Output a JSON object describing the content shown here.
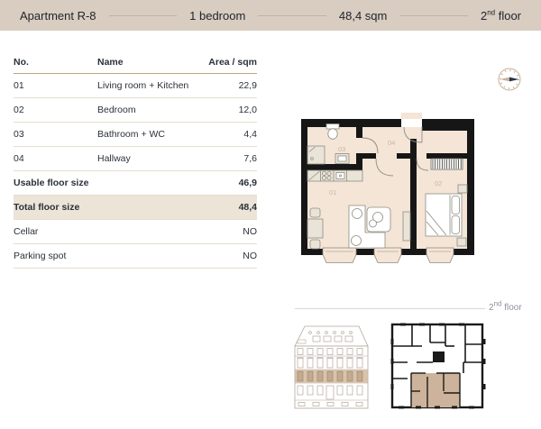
{
  "header": {
    "title": "Apartment R-8",
    "bedrooms": "1 bedroom",
    "area": "48,4 sqm",
    "floor": {
      "num": "2",
      "sup": "nd",
      "word": " floor"
    }
  },
  "table": {
    "headers": {
      "no": "No.",
      "name": "Name",
      "area": "Area / sqm"
    },
    "rows": [
      {
        "no": "01",
        "name": "Living room + Kitchen",
        "area": "22,9"
      },
      {
        "no": "02",
        "name": "Bedroom",
        "area": "12,0"
      },
      {
        "no": "03",
        "name": "Bathroom + WC",
        "area": "4,4"
      },
      {
        "no": "04",
        "name": "Hallway",
        "area": "7,6"
      }
    ],
    "summary": {
      "usable": {
        "label": "Usable floor size",
        "value": "46,9"
      },
      "total": {
        "label": "Total floor size",
        "value": "48,4"
      },
      "cellar": {
        "label": "Cellar",
        "value": "NO"
      },
      "parking": {
        "label": "Parking spot",
        "value": "NO"
      }
    }
  },
  "floorplan": {
    "labels": {
      "living": "01",
      "bedroom": "02",
      "bathroom": "03",
      "hallway": "04"
    }
  },
  "footer": {
    "floor": {
      "num": "2",
      "sup": "nd",
      "word": " floor"
    }
  },
  "colors": {
    "band": "#d8cdc0",
    "highlight_row": "#ece4d6",
    "plan_floor": "#f5e5d6",
    "plan_wall": "#161616",
    "plan_label": "#c9b7a6",
    "elevation_highlight": "#d9c3ac",
    "miniplan_highlight": "#cdb39b",
    "compass": "#c8b29a",
    "needle": "#2b3240"
  }
}
